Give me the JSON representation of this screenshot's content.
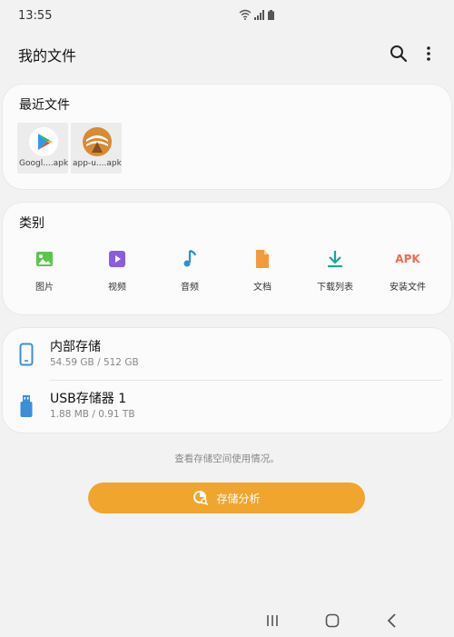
{
  "status": {
    "time": "13:55"
  },
  "header": {
    "title": "我的文件"
  },
  "recent": {
    "title": "最近文件",
    "files": [
      {
        "name": "Googl....apk"
      },
      {
        "name": "app-u....apk"
      }
    ]
  },
  "categories": {
    "title": "类别",
    "items": [
      {
        "label": "图片"
      },
      {
        "label": "视频"
      },
      {
        "label": "音频"
      },
      {
        "label": "文档"
      },
      {
        "label": "下载列表"
      },
      {
        "label": "安装文件",
        "icon_text": "APK"
      }
    ]
  },
  "storage": [
    {
      "name": "内部存储",
      "size": "54.59 GB / 512 GB"
    },
    {
      "name": "USB存储器 1",
      "size": "1.88 MB / 0.91 TB"
    }
  ],
  "hint": "查看存储空间使用情况。",
  "analyze_button": "存储分析",
  "colors": {
    "accent": "#f0a52e",
    "images": "#5cc44e",
    "video": "#8a5ce0",
    "audio": "#2e8fd8",
    "docs": "#f39b3b",
    "download": "#1aa896",
    "apk": "#f46a4e",
    "storage_icon": "#3a8fd8"
  }
}
